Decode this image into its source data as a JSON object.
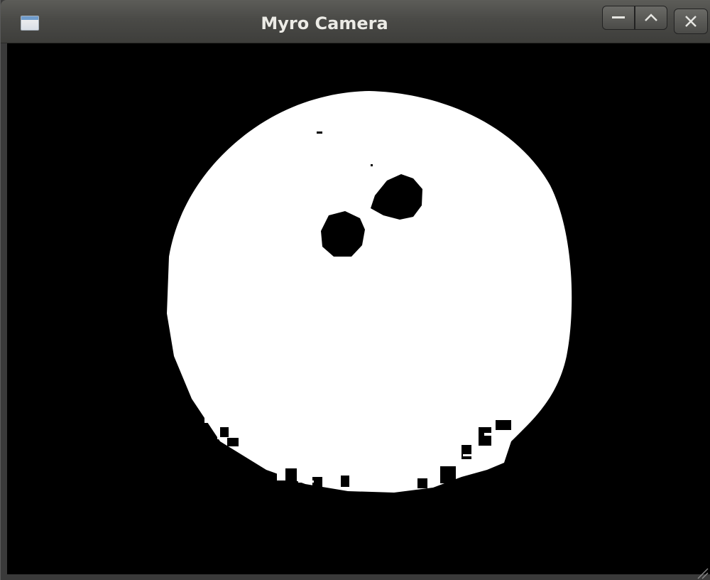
{
  "window": {
    "title": "Myro Camera",
    "icon": "window-app-icon"
  },
  "controls": {
    "minimize_icon": "minimize-icon",
    "maximize_icon": "maximize-icon",
    "close_icon": "close-icon"
  },
  "image": {
    "description_colors": {
      "background": "#000000",
      "foreground": "#ffffff"
    }
  }
}
